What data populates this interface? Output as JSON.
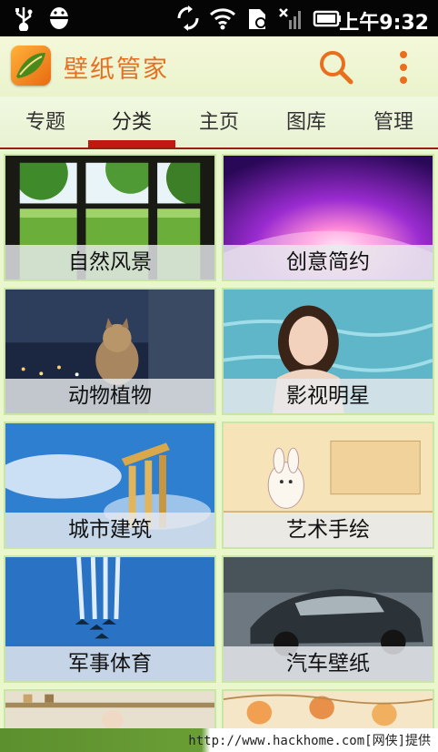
{
  "status_bar": {
    "time": "上午9:32",
    "icons": [
      "usb-icon",
      "android-debug-icon",
      "sync-icon",
      "wifi-icon",
      "sd-card-icon",
      "no-signal-icon",
      "battery-icon"
    ]
  },
  "header": {
    "app_title": "壁纸管家",
    "brand_color": "#e86f1e"
  },
  "tabs": [
    {
      "label": "专题"
    },
    {
      "label": "分类"
    },
    {
      "label": "主页"
    },
    {
      "label": "图库"
    },
    {
      "label": "管理"
    }
  ],
  "active_tab": "分类",
  "categories": [
    {
      "label": "自然风景"
    },
    {
      "label": "创意简约"
    },
    {
      "label": "动物植物"
    },
    {
      "label": "影视明星"
    },
    {
      "label": "城市建筑"
    },
    {
      "label": "艺术手绘"
    },
    {
      "label": "军事体育"
    },
    {
      "label": "汽车壁纸"
    }
  ],
  "watermark": "http://www.hackhome.com[网侠]提供",
  "colors": {
    "tab_indicator": "#c01a10",
    "background": "#eaf7cc"
  }
}
